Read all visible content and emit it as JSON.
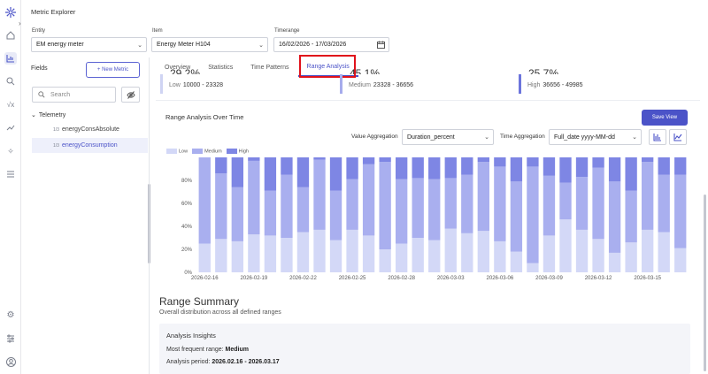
{
  "app": {
    "title": "Metric Explorer"
  },
  "rail": {
    "icons": [
      "logo-icon",
      "home-icon",
      "chart-icon",
      "search-icon",
      "formula-icon",
      "trend-icon",
      "sparkle-icon",
      "menu-icon",
      "settings-icon",
      "sliders-icon",
      "user-icon"
    ]
  },
  "filters": {
    "entity": {
      "label": "Entity",
      "value": "EM energy meter"
    },
    "item": {
      "label": "Item",
      "value": "Energy Meter H104"
    },
    "timerange": {
      "label": "Timerange",
      "value": "16/02/2026 - 17/03/2026"
    }
  },
  "sidebar": {
    "fields_title": "Fields",
    "new_metric": "+ New Metric",
    "search_placeholder": "Search",
    "group": "Telemetry",
    "items": [
      {
        "tag": "1/3",
        "label": "energyConsAbsolute",
        "selected": false
      },
      {
        "tag": "1/3",
        "label": "energyConsumption",
        "selected": true
      }
    ]
  },
  "tabs": [
    {
      "label": "Overview",
      "active": false
    },
    {
      "label": "Statistics",
      "active": false
    },
    {
      "label": "Time Patterns",
      "active": false
    },
    {
      "label": "Range Analysis",
      "active": true
    }
  ],
  "stats": [
    {
      "pct": "29.2%",
      "name": "Low",
      "range": "10000 - 23328",
      "color": "#cfd4f3"
    },
    {
      "pct": "45.1%",
      "name": "Medium",
      "range": "23328 - 36656",
      "color": "#a6acec"
    },
    {
      "pct": "25.7%",
      "name": "High",
      "range": "36656 - 49985",
      "color": "#6c75dc"
    }
  ],
  "chart_panel": {
    "title": "Range Analysis Over Time",
    "save_view": "Save View",
    "value_aggregation_label": "Value Aggregation",
    "value_aggregation": "Duration_percent",
    "time_aggregation_label": "Time Aggregation",
    "time_aggregation": "Full_date yyyy-MM-dd"
  },
  "colors": {
    "accent": "#4b53c8",
    "low": "#d3d8f7",
    "medium": "#a9afef",
    "high": "#7e86e4",
    "highlight_box": "#e0121b"
  },
  "chart_data": {
    "type": "bar",
    "stacked": true,
    "x_tick_labels": [
      "2026-02-16",
      "2026-02-19",
      "2026-02-22",
      "2026-02-25",
      "2026-02-28",
      "2026-03-03",
      "2026-03-06",
      "2026-03-09",
      "2026-03-12",
      "2026-03-15"
    ],
    "y_tick_labels": [
      "0%",
      "20%",
      "40%",
      "60%",
      "80%"
    ],
    "ylim": [
      0,
      100
    ],
    "legend": [
      "Low",
      "Medium",
      "High"
    ],
    "categories": [
      "2026-02-16",
      "2026-02-17",
      "2026-02-18",
      "2026-02-19",
      "2026-02-20",
      "2026-02-21",
      "2026-02-22",
      "2026-02-23",
      "2026-02-24",
      "2026-02-25",
      "2026-02-26",
      "2026-02-27",
      "2026-02-28",
      "2026-03-01",
      "2026-03-02",
      "2026-03-03",
      "2026-03-04",
      "2026-03-05",
      "2026-03-06",
      "2026-03-07",
      "2026-03-08",
      "2026-03-09",
      "2026-03-10",
      "2026-03-11",
      "2026-03-12",
      "2026-03-13",
      "2026-03-14",
      "2026-03-15",
      "2026-03-16",
      "2026-03-17"
    ],
    "series": [
      {
        "name": "Low",
        "values": [
          25,
          29,
          27,
          33,
          32,
          30,
          35,
          37,
          28,
          37,
          32,
          20,
          25,
          30,
          28,
          38,
          34,
          36,
          27,
          18,
          8,
          32,
          46,
          37,
          29,
          17,
          26,
          37,
          35,
          21
        ]
      },
      {
        "name": "Medium",
        "values": [
          75,
          57,
          47,
          64,
          39,
          55,
          39,
          61,
          43,
          44,
          62,
          76,
          56,
          52,
          53,
          44,
          51,
          60,
          65,
          61,
          84,
          52,
          32,
          46,
          62,
          62,
          45,
          59,
          50,
          64
        ]
      },
      {
        "name": "High",
        "values": [
          0,
          14,
          26,
          3,
          29,
          15,
          26,
          2,
          29,
          19,
          6,
          4,
          19,
          18,
          19,
          18,
          15,
          4,
          8,
          21,
          8,
          16,
          22,
          17,
          9,
          21,
          29,
          4,
          15,
          15
        ]
      }
    ]
  },
  "summary": {
    "title": "Range Summary",
    "subtitle": "Overall distribution across all defined ranges",
    "insights_title": "Analysis Insights",
    "most_frequent_label": "Most frequent range:",
    "most_frequent_value": "Medium",
    "period_label": "Analysis period:",
    "period_value": "2026.02.16 - 2026.03.17"
  }
}
